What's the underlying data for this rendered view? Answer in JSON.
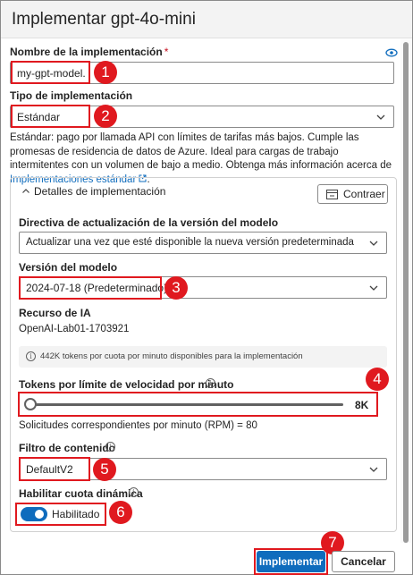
{
  "panel": {
    "title": "Implementar gpt-4o-mini"
  },
  "deployment_name": {
    "label": "Nombre de la implementación",
    "required_mark": "*",
    "value": "my-gpt-model."
  },
  "deployment_type": {
    "label": "Tipo de implementación",
    "value": "Estándar",
    "description": "Estándar: pago por llamada API con límites de tarifas más bajos. Cumple las promesas de residencia de datos de Azure. Ideal para cargas de trabajo intermitentes con un volumen de bajo a medio. Obtenga más información acerca de ",
    "link_text": "Implementaciones estándar"
  },
  "details": {
    "header": "Detalles de implementación",
    "collapse_label": "Contraer",
    "update_policy": {
      "label": "Directiva de actualización de la versión del modelo",
      "value": "Actualizar una vez que esté disponible la nueva versión predeterminada"
    },
    "model_version": {
      "label": "Versión del modelo",
      "value": "2024-07-18 (Predeterminado)"
    },
    "ai_resource": {
      "label": "Recurso de IA",
      "value": "OpenAI-Lab01-1703921"
    },
    "quota_info": "442K tokens por cuota por minuto disponibles para la implementación",
    "tpm": {
      "label": "Tokens por límite de velocidad por minuto",
      "value_text": "8K",
      "fraction": 0.02,
      "rpm_text": "Solicitudes correspondientes por minuto (RPM) = 80"
    },
    "content_filter": {
      "label": "Filtro de contenido",
      "value": "DefaultV2"
    },
    "dynamic_quota": {
      "label": "Habilitar cuota dinámica",
      "state_text": "Habilitado",
      "enabled": true
    }
  },
  "footer": {
    "deploy_label": "Implementar",
    "cancel_label": "Cancelar"
  },
  "annotations": [
    "1",
    "2",
    "3",
    "4",
    "5",
    "6",
    "7"
  ],
  "colors": {
    "accent": "#0f6cbd",
    "highlight": "#e0191f"
  }
}
